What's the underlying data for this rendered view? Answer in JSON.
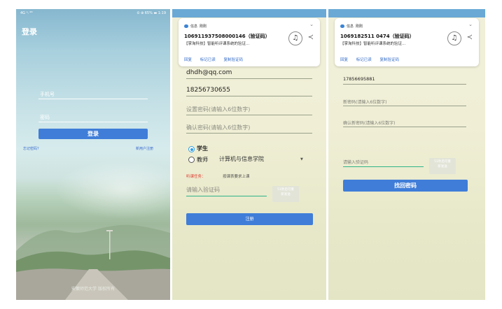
{
  "login": {
    "status_left": "4G ᵃᵢ ⁴ᴳ",
    "status_right": "⏲ ⊕ 65% ▬ 1:19",
    "title": "登录",
    "phone_placeholder": "手机号",
    "password_placeholder": "密码",
    "login_button": "登录",
    "forgot_link": "忘记密码？",
    "register_link": "新用户注册",
    "footer": "安徽师范大学 版权所有"
  },
  "register": {
    "notification": {
      "app": "信息",
      "time": "刚刚",
      "sender": "106911937508000146（验证码）",
      "body": "【掌淘科技】智能听评课系统的验证...",
      "actions": [
        "回复",
        "标记已读",
        "复制验证码"
      ]
    },
    "email_value": "dhdh@qq.com",
    "phone_value": "18256730655",
    "password_placeholder": "设置密码(请输入6位数字)",
    "confirm_placeholder": "确认密码(请输入6位数字)",
    "role_student": "学生",
    "role_teacher": "教师",
    "college": "计算机与信息学院",
    "task_label": "听课任务：",
    "task_value": "按课表要求上课",
    "code_placeholder": "请输入验证码",
    "code_button_line1": "51秒后可重",
    "code_button_line2": "新发送",
    "register_button": "注册"
  },
  "reset": {
    "notification": {
      "app": "信息",
      "time": "刚刚",
      "sender": "1069182511 0474（验证码）",
      "body": "【掌淘科技】智能听评课系统的验证...",
      "actions": [
        "回复",
        "标记已读",
        "复制验证码"
      ]
    },
    "phone_value": "17856695881",
    "new_password_placeholder": "新密码(请输入6位数字)",
    "confirm_new_placeholder": "确认新密码(请输入6位数字)",
    "code_placeholder": "请输入验证码",
    "code_button_line1": "51秒后可重",
    "code_button_line2": "新发送",
    "retrieve_button": "找回密码"
  },
  "colors": {
    "primary_button": "#3f7dd8",
    "link": "#2f69c8",
    "task_red": "#e03a2e"
  }
}
